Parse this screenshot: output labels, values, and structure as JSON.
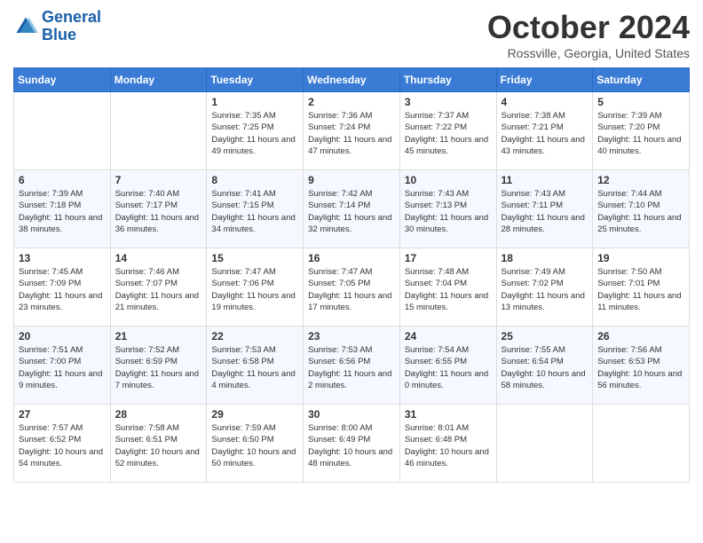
{
  "header": {
    "logo_line1": "General",
    "logo_line2": "Blue",
    "month": "October 2024",
    "location": "Rossville, Georgia, United States"
  },
  "days_of_week": [
    "Sunday",
    "Monday",
    "Tuesday",
    "Wednesday",
    "Thursday",
    "Friday",
    "Saturday"
  ],
  "weeks": [
    [
      {
        "day": "",
        "info": ""
      },
      {
        "day": "",
        "info": ""
      },
      {
        "day": "1",
        "info": "Sunrise: 7:35 AM\nSunset: 7:25 PM\nDaylight: 11 hours and 49 minutes."
      },
      {
        "day": "2",
        "info": "Sunrise: 7:36 AM\nSunset: 7:24 PM\nDaylight: 11 hours and 47 minutes."
      },
      {
        "day": "3",
        "info": "Sunrise: 7:37 AM\nSunset: 7:22 PM\nDaylight: 11 hours and 45 minutes."
      },
      {
        "day": "4",
        "info": "Sunrise: 7:38 AM\nSunset: 7:21 PM\nDaylight: 11 hours and 43 minutes."
      },
      {
        "day": "5",
        "info": "Sunrise: 7:39 AM\nSunset: 7:20 PM\nDaylight: 11 hours and 40 minutes."
      }
    ],
    [
      {
        "day": "6",
        "info": "Sunrise: 7:39 AM\nSunset: 7:18 PM\nDaylight: 11 hours and 38 minutes."
      },
      {
        "day": "7",
        "info": "Sunrise: 7:40 AM\nSunset: 7:17 PM\nDaylight: 11 hours and 36 minutes."
      },
      {
        "day": "8",
        "info": "Sunrise: 7:41 AM\nSunset: 7:15 PM\nDaylight: 11 hours and 34 minutes."
      },
      {
        "day": "9",
        "info": "Sunrise: 7:42 AM\nSunset: 7:14 PM\nDaylight: 11 hours and 32 minutes."
      },
      {
        "day": "10",
        "info": "Sunrise: 7:43 AM\nSunset: 7:13 PM\nDaylight: 11 hours and 30 minutes."
      },
      {
        "day": "11",
        "info": "Sunrise: 7:43 AM\nSunset: 7:11 PM\nDaylight: 11 hours and 28 minutes."
      },
      {
        "day": "12",
        "info": "Sunrise: 7:44 AM\nSunset: 7:10 PM\nDaylight: 11 hours and 25 minutes."
      }
    ],
    [
      {
        "day": "13",
        "info": "Sunrise: 7:45 AM\nSunset: 7:09 PM\nDaylight: 11 hours and 23 minutes."
      },
      {
        "day": "14",
        "info": "Sunrise: 7:46 AM\nSunset: 7:07 PM\nDaylight: 11 hours and 21 minutes."
      },
      {
        "day": "15",
        "info": "Sunrise: 7:47 AM\nSunset: 7:06 PM\nDaylight: 11 hours and 19 minutes."
      },
      {
        "day": "16",
        "info": "Sunrise: 7:47 AM\nSunset: 7:05 PM\nDaylight: 11 hours and 17 minutes."
      },
      {
        "day": "17",
        "info": "Sunrise: 7:48 AM\nSunset: 7:04 PM\nDaylight: 11 hours and 15 minutes."
      },
      {
        "day": "18",
        "info": "Sunrise: 7:49 AM\nSunset: 7:02 PM\nDaylight: 11 hours and 13 minutes."
      },
      {
        "day": "19",
        "info": "Sunrise: 7:50 AM\nSunset: 7:01 PM\nDaylight: 11 hours and 11 minutes."
      }
    ],
    [
      {
        "day": "20",
        "info": "Sunrise: 7:51 AM\nSunset: 7:00 PM\nDaylight: 11 hours and 9 minutes."
      },
      {
        "day": "21",
        "info": "Sunrise: 7:52 AM\nSunset: 6:59 PM\nDaylight: 11 hours and 7 minutes."
      },
      {
        "day": "22",
        "info": "Sunrise: 7:53 AM\nSunset: 6:58 PM\nDaylight: 11 hours and 4 minutes."
      },
      {
        "day": "23",
        "info": "Sunrise: 7:53 AM\nSunset: 6:56 PM\nDaylight: 11 hours and 2 minutes."
      },
      {
        "day": "24",
        "info": "Sunrise: 7:54 AM\nSunset: 6:55 PM\nDaylight: 11 hours and 0 minutes."
      },
      {
        "day": "25",
        "info": "Sunrise: 7:55 AM\nSunset: 6:54 PM\nDaylight: 10 hours and 58 minutes."
      },
      {
        "day": "26",
        "info": "Sunrise: 7:56 AM\nSunset: 6:53 PM\nDaylight: 10 hours and 56 minutes."
      }
    ],
    [
      {
        "day": "27",
        "info": "Sunrise: 7:57 AM\nSunset: 6:52 PM\nDaylight: 10 hours and 54 minutes."
      },
      {
        "day": "28",
        "info": "Sunrise: 7:58 AM\nSunset: 6:51 PM\nDaylight: 10 hours and 52 minutes."
      },
      {
        "day": "29",
        "info": "Sunrise: 7:59 AM\nSunset: 6:50 PM\nDaylight: 10 hours and 50 minutes."
      },
      {
        "day": "30",
        "info": "Sunrise: 8:00 AM\nSunset: 6:49 PM\nDaylight: 10 hours and 48 minutes."
      },
      {
        "day": "31",
        "info": "Sunrise: 8:01 AM\nSunset: 6:48 PM\nDaylight: 10 hours and 46 minutes."
      },
      {
        "day": "",
        "info": ""
      },
      {
        "day": "",
        "info": ""
      }
    ]
  ]
}
